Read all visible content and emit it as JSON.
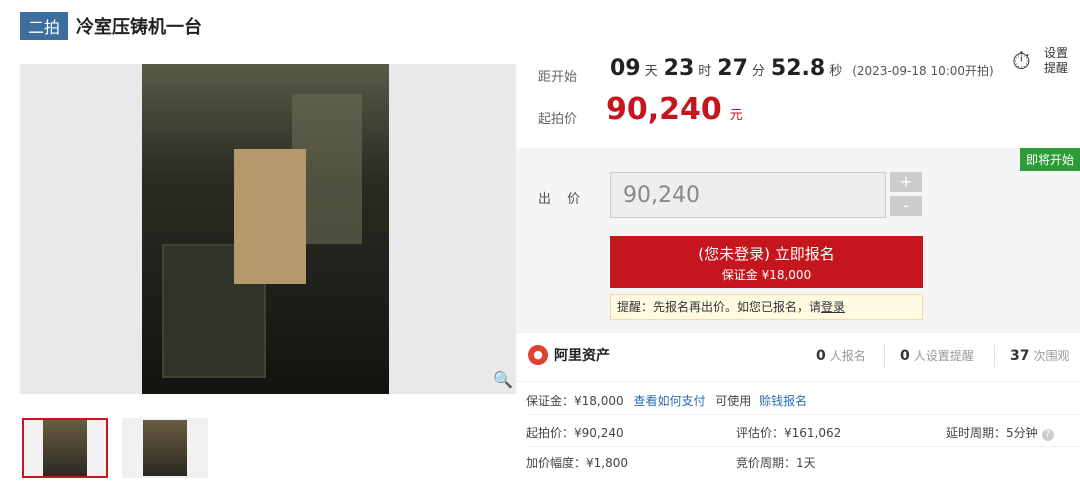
{
  "header": {
    "round": "二拍",
    "title": "冷室压铸机一台"
  },
  "countdown": {
    "label": "距开始",
    "days": "09",
    "days_unit": "天",
    "hours": "23",
    "hours_unit": "时",
    "minutes": "27",
    "minutes_unit": "分",
    "seconds": "52.8",
    "seconds_unit": "秒",
    "start_time": "(2023-09-18 10:00开拍)"
  },
  "remind": {
    "label": "设置提醒",
    "icon": "alarm-clock-icon"
  },
  "starting_price": {
    "label": "起拍价",
    "amount": "90,240",
    "unit": "元"
  },
  "status_badge": "即将开始",
  "bid": {
    "label": "出 价",
    "value": "90,240",
    "plus": "+",
    "minus": "-"
  },
  "signup": {
    "title": "(您未登录) 立即报名",
    "deposit": "保证金 ¥18,000"
  },
  "tip": {
    "text": "提醒：先报名再出价。如您已报名，请",
    "link": "登录"
  },
  "stats": {
    "brand": "阿里资产",
    "signed_up": "0",
    "signed_up_label": "人报名",
    "reminders": "0",
    "reminders_label": "人设置提醒",
    "views": "37",
    "views_label": "次围观"
  },
  "details": {
    "deposit_label": "保证金：¥18,000",
    "how_to_pay": "查看如何支付",
    "can_use": "可使用",
    "loan_signup": "赊钱报名",
    "start_price": "起拍价：¥90,240",
    "appraisal": "评估价：¥161,062",
    "delay": "延时周期：5分钟",
    "increment": "加价幅度：¥1,800",
    "cycle": "竞价周期：1天"
  },
  "colors": {
    "accent": "#c5161d",
    "badge_green": "#2e9b3b",
    "link": "#2c6bb6",
    "round_badge": "#3d6e9e"
  }
}
